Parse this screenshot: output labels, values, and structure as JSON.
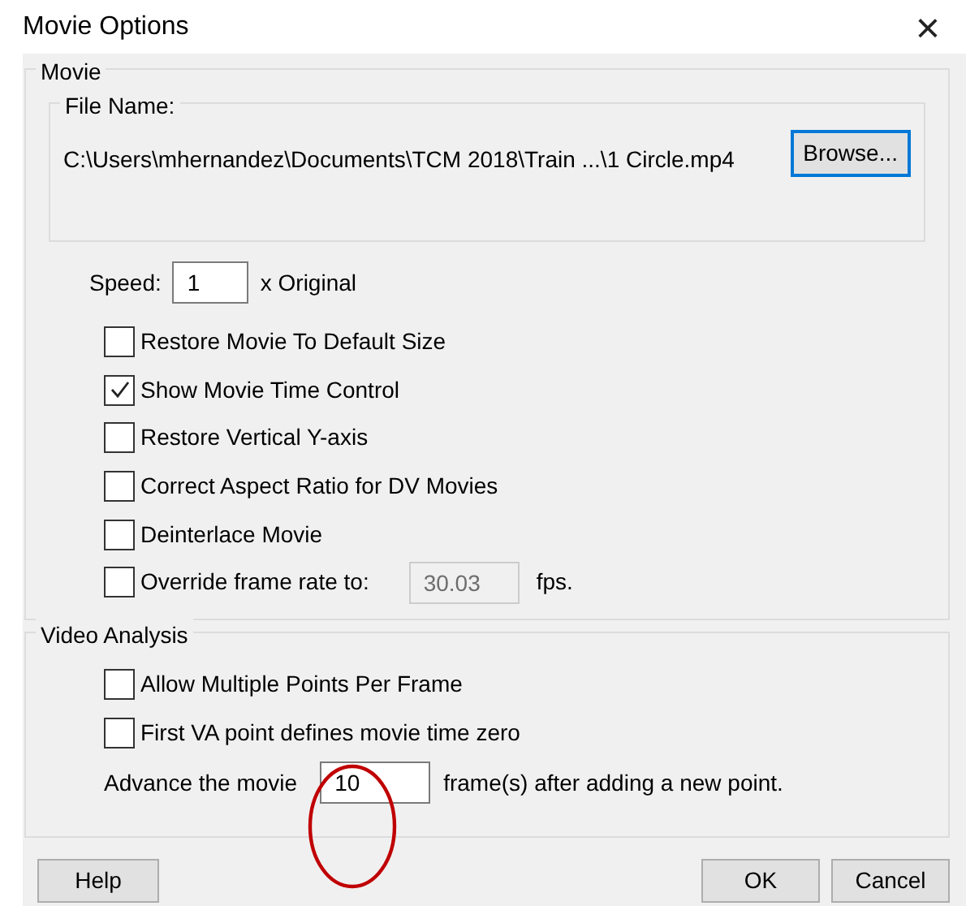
{
  "window": {
    "title": "Movie Options",
    "close": "×"
  },
  "movie_group": {
    "title": "Movie",
    "file": {
      "label": "File Name:",
      "path": "C:\\Users\\mhernandez\\Documents\\TCM 2018\\Train ...\\1 Circle.mp4",
      "browse": "Browse...",
      "browse_focused": true
    },
    "speed": {
      "label": "Speed:",
      "value": "1",
      "suffix": "x Original"
    },
    "options": [
      {
        "label": "Restore Movie To Default Size",
        "checked": false
      },
      {
        "label": "Show Movie Time Control",
        "checked": true
      },
      {
        "label": "Restore Vertical Y-axis",
        "checked": false
      },
      {
        "label": "Correct Aspect Ratio for DV Movies",
        "checked": false
      },
      {
        "label": "Deinterlace Movie",
        "checked": false
      },
      {
        "label": "Override frame rate to:",
        "checked": false,
        "field": {
          "value": "30.03",
          "disabled": true,
          "suffix": "fps."
        }
      }
    ]
  },
  "video_group": {
    "title": "Video Analysis",
    "options": [
      {
        "label": "Allow Multiple Points Per Frame",
        "checked": false
      },
      {
        "label": "First VA point defines movie time zero",
        "checked": false
      }
    ],
    "advance": {
      "label": "Advance the movie",
      "value": "10",
      "suffix": "frame(s) after adding a new point.",
      "circled": true
    }
  },
  "buttons": [
    {
      "label": "Help",
      "kind": "left"
    },
    {
      "label": "OK",
      "kind": "right"
    },
    {
      "label": "Cancel",
      "kind": "right"
    }
  ]
}
